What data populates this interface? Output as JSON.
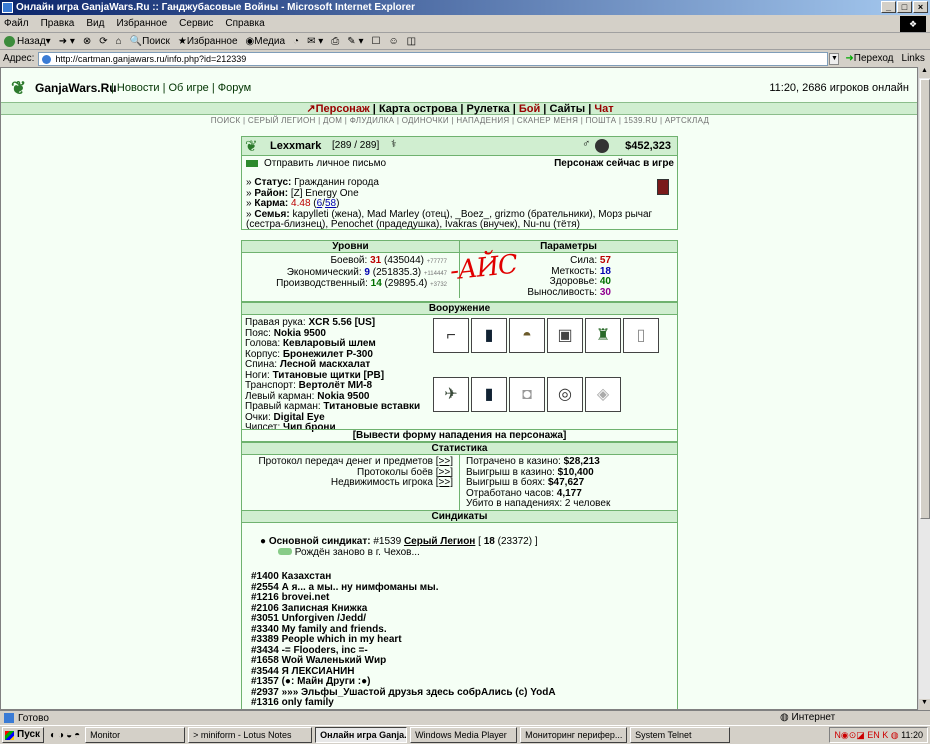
{
  "window": {
    "title": "Онлайн игра GanjaWars.Ru :: Ганджубасовые Войны - Microsoft Internet Explorer"
  },
  "menubar": [
    "Файл",
    "Правка",
    "Вид",
    "Избранное",
    "Сервис",
    "Справка"
  ],
  "toolbar": {
    "back": "Назад",
    "search": "Поиск",
    "favorites": "Избранное",
    "media": "Медиа"
  },
  "address": {
    "label": "Адрес:",
    "url": "http://cartman.ganjawars.ru/info.php?id=212339",
    "go": "Переход",
    "links": "Links"
  },
  "site": {
    "logo": "GanjaWars.Ru",
    "nav": [
      "Новости",
      "Об игре",
      "Форум"
    ],
    "online": "11:20, 2686 игроков онлайн",
    "menu": [
      "Персонаж",
      "Карта острова",
      "Рулетка",
      "Бой",
      "Сайты",
      "Чат"
    ],
    "submenu": "ПОИСК | СЕРЫЙ ЛЕГИОН | ДОМ | ФЛУДИЛКА | ОДИНОЧКИ | НАПАДЕНИЯ | СКАНЕР МЕНЯ | ПОШТА | 1539.RU | АРТСКЛАД"
  },
  "player": {
    "name": "Lexxmark",
    "hp": "[289 / 289]",
    "money": "$452,323",
    "mail": "Отправить личное письмо",
    "ingame": "Персонаж сейчас в игре",
    "status_label": "Статус:",
    "status": "Гражданин города",
    "district_label": "Район:",
    "district": "[Z] Energy One",
    "karma_label": "Карма:",
    "karma": "4.48",
    "karma_a": "6",
    "karma_b": "58",
    "family_label": "Семья:",
    "family": "kapylleti (жена), Mad Marley (отец), _Boez_, grizmo (брательники), Морз рычаг (сестра-близнец), Penochet (прадедушка), Ivakras (внучек), Nu-nu (тётя)"
  },
  "levels": {
    "header": "Уровни",
    "rows": [
      {
        "label": "Боевой:",
        "level": "31",
        "exp": "(435044)",
        "plus": "+77777"
      },
      {
        "label": "Экономический:",
        "level": "9",
        "exp": "(251835.3)",
        "plus": "+114447"
      },
      {
        "label": "Производственный:",
        "level": "14",
        "exp": "(29895.4)",
        "plus": "+3732"
      }
    ],
    "annotation": "-АЙС"
  },
  "params": {
    "header": "Параметры",
    "rows": [
      {
        "label": "Сила:",
        "value": "57",
        "color": "#b00000"
      },
      {
        "label": "Меткость:",
        "value": "18",
        "color": "#0000b0"
      },
      {
        "label": "Здоровье:",
        "value": "40",
        "color": "#007000"
      },
      {
        "label": "Выносливость:",
        "value": "30",
        "color": "#900090"
      }
    ]
  },
  "armament": {
    "header": "Вооружение",
    "rows": [
      {
        "label": "Правая рука:",
        "value": "XCR 5.56 [US]"
      },
      {
        "label": "Пояс:",
        "value": "Nokia 9500"
      },
      {
        "label": "Голова:",
        "value": "Кевларовый шлем"
      },
      {
        "label": "Корпус:",
        "value": "Бронежилет Р-300"
      },
      {
        "label": "Спина:",
        "value": "Лесной маскхалат"
      },
      {
        "label": "Ноги:",
        "value": "Титановые щитки [PB]"
      },
      {
        "label": "Транспорт:",
        "value": "Вертолёт МИ-8"
      },
      {
        "label": "Левый карман:",
        "value": "Nokia 9500"
      },
      {
        "label": "Правый карман:",
        "value": "Титановые вставки"
      },
      {
        "label": "Очки:",
        "value": "Digital Eye"
      },
      {
        "label": "Чипсет:",
        "value": "Чип брони"
      }
    ],
    "attack_form": "[Вывести форму нападения на персонажа]"
  },
  "stats": {
    "header": "Статистика",
    "left": [
      {
        "label": "Протокол передач денег и предметов",
        "btn": "[>>]"
      },
      {
        "label": "Протоколы боёв",
        "btn": "[>>]"
      },
      {
        "label": "Недвижимость игрока",
        "btn": "[>>]"
      }
    ],
    "right": [
      {
        "label": "Потрачено в казино:",
        "value": "$28,213"
      },
      {
        "label": "Выигрыш в казино:",
        "value": "$10,400"
      },
      {
        "label": "Выигрыш в боях:",
        "value": "$47,627"
      },
      {
        "label": "Отработано часов:",
        "value": "4,177"
      },
      {
        "label": "Убито в нападениях:",
        "value": "2 человек"
      }
    ]
  },
  "syndicates": {
    "header": "Синдикаты",
    "main_label": "Основной синдикат:",
    "main_id": "#1539",
    "main_name": "Серый Легион",
    "main_level": "18",
    "main_exp": "(23372)",
    "reborn": "Рождён заново в г. Чехов...",
    "list": [
      "#1400 Казахстан",
      "#2554 А я... а мы.. ну нимфоманы мы.",
      "#1216 brovei.net",
      "#2106 Записная Книжка",
      "#3051 Unforgiven /Jedd/",
      "#3340 My family and friends.",
      "#3389 People which in my heart",
      "#3434 -= Flooders, inc =-",
      "#1658 Woй Waленький Wир",
      "#3544 Я ЛЕКСИАНИН",
      "#1357 (●: Майн Други :●)",
      "#2937 »»» Эльфы_Ушастой друзья здесь собрАлись (c) YodA",
      "#1316 only family"
    ]
  },
  "statusbar": {
    "left": "Готово",
    "right": "Интернет"
  },
  "taskbar": {
    "start": "Пуск",
    "tasks": [
      "Monitor",
      "> miniform - Lotus Notes",
      "Онлайн игра Ganja...",
      "Windows Media Player",
      "Мониторинг перифер...",
      "System Telnet"
    ],
    "clock": "11:20"
  }
}
